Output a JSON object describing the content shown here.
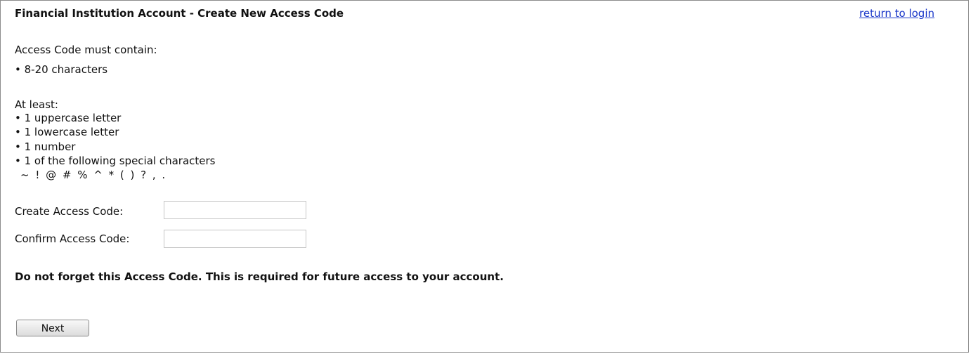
{
  "header": {
    "title": "Financial Institution Account - Create New Access Code",
    "return_link": "return to login"
  },
  "requirements": {
    "intro": "Access Code must contain:",
    "length_rule": "• 8-20 characters",
    "at_least_label": "At least:",
    "rules": [
      "• 1 uppercase letter",
      "• 1 lowercase letter",
      "• 1 number",
      "• 1 of the following special characters"
    ],
    "special_characters": "~ ! @ # % ^ * ( ) ? , ."
  },
  "form": {
    "create_label": "Create Access Code:",
    "create_value": "",
    "confirm_label": "Confirm Access Code:",
    "confirm_value": ""
  },
  "notice": "Do not forget this Access Code. This is required for future access to your account.",
  "actions": {
    "next_label": "Next"
  },
  "colors": {
    "link": "#1a37c9",
    "border": "#8c8c8c"
  }
}
